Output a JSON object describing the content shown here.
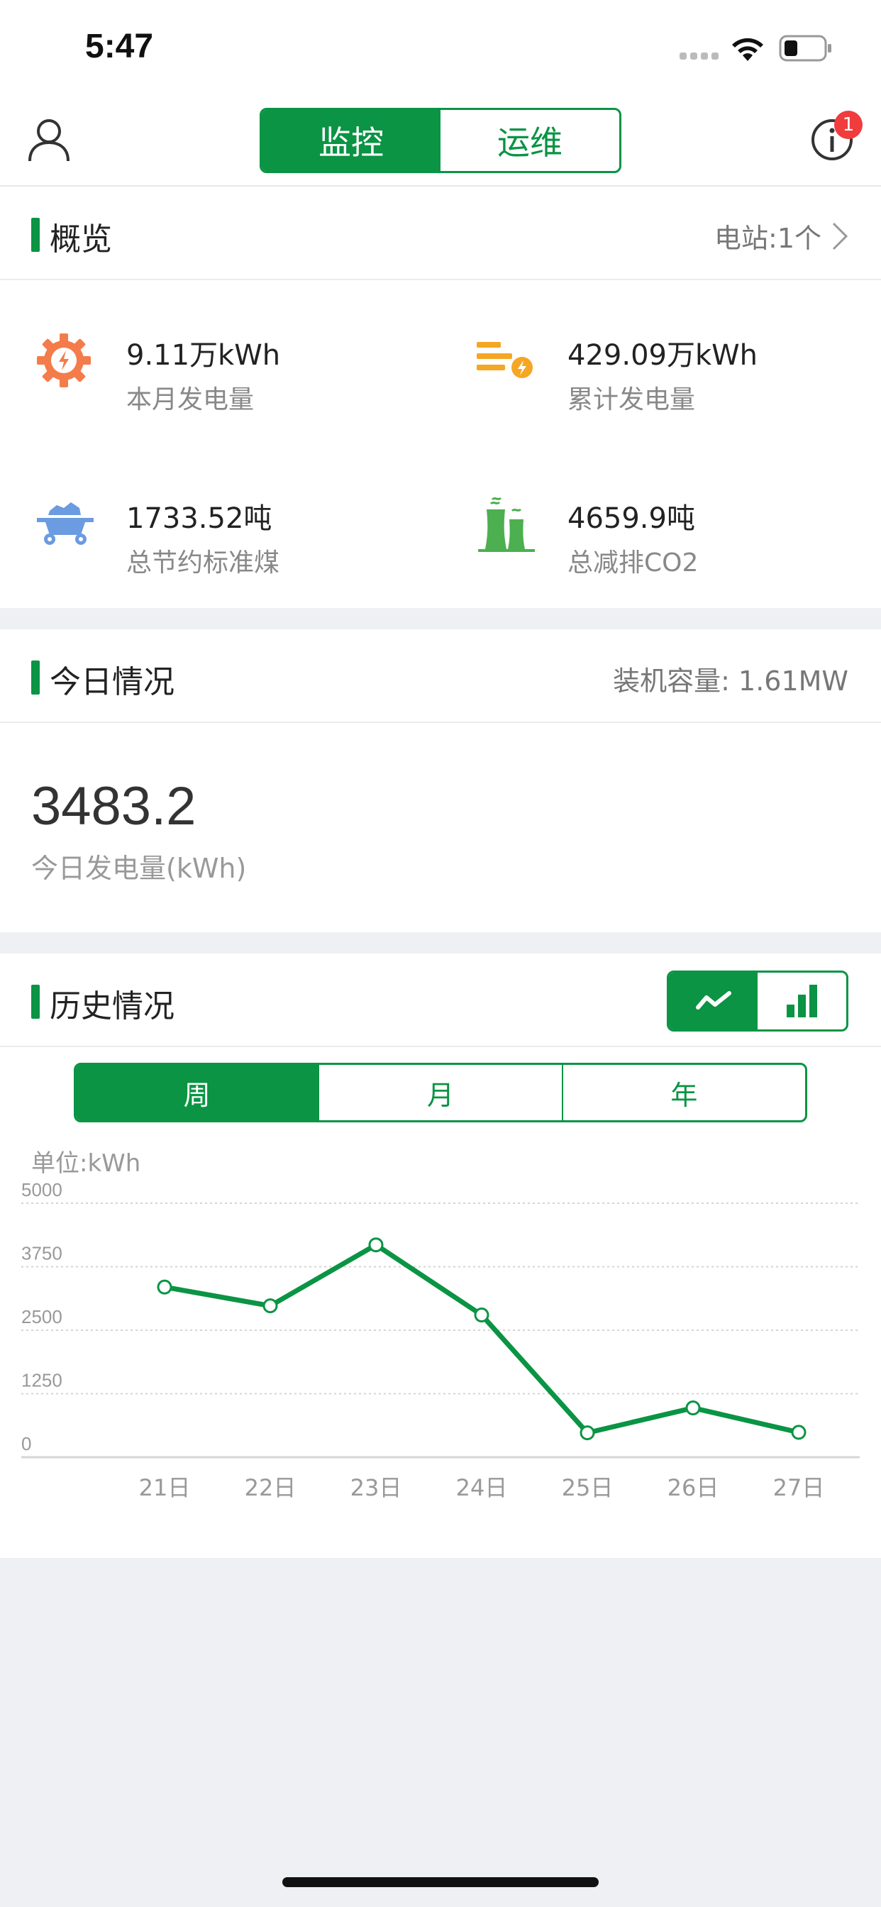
{
  "status": {
    "time": "5:47"
  },
  "header": {
    "tabs": [
      {
        "label": "监控",
        "active": true
      },
      {
        "label": "运维",
        "active": false
      }
    ],
    "notification_count": "1"
  },
  "overview": {
    "title": "概览",
    "station_link": "电站:1个",
    "stats": [
      {
        "value": "9.11万kWh",
        "label": "本月发电量",
        "icon": "gear-lightning-icon"
      },
      {
        "value": "429.09万kWh",
        "label": "累计发电量",
        "icon": "energy-lines-icon"
      },
      {
        "value": "1733.52吨",
        "label": "总节约标准煤",
        "icon": "coal-cart-icon"
      },
      {
        "value": "4659.9吨",
        "label": "总减排CO2",
        "icon": "cooling-tower-icon"
      }
    ]
  },
  "today": {
    "title": "今日情况",
    "capacity": "装机容量: 1.61MW",
    "generation_value": "3483.2",
    "generation_label": "今日发电量(kWh)"
  },
  "history": {
    "title": "历史情况",
    "chart_types": [
      {
        "icon": "line-chart-icon",
        "active": true
      },
      {
        "icon": "bar-chart-icon",
        "active": false
      }
    ],
    "periods": [
      {
        "label": "周",
        "active": true
      },
      {
        "label": "月",
        "active": false
      },
      {
        "label": "年",
        "active": false
      }
    ],
    "unit": "单位:kWh"
  },
  "colors": {
    "accent": "#0a9444",
    "badge": "#f03c3c",
    "orange": "#f47c4a",
    "amber": "#f5a623",
    "blue": "#6b9be0",
    "plant": "#4caf50"
  },
  "chart_data": {
    "type": "line",
    "categories": [
      "21日",
      "22日",
      "23日",
      "24日",
      "25日",
      "26日",
      "27日"
    ],
    "values": [
      3350,
      2980,
      4180,
      2800,
      480,
      970,
      490
    ],
    "yticks": [
      "5000",
      "3750",
      "2500",
      "1250",
      "0"
    ],
    "ylim": [
      0,
      5000
    ],
    "grid": true
  }
}
